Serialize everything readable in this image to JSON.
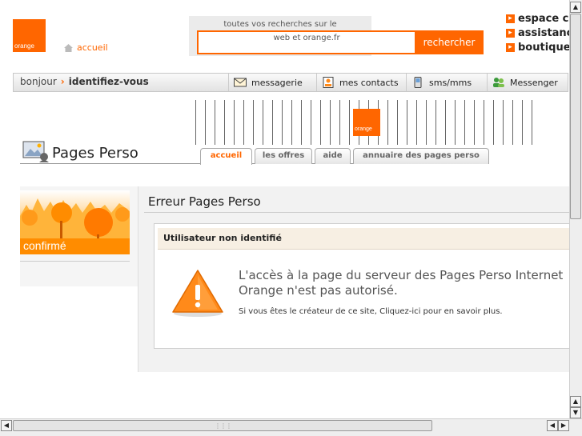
{
  "header": {
    "logo_text": "orange",
    "home_label": "accueil",
    "search": {
      "hint_line1": "toutes vos recherches sur le",
      "placeholder": "web et orange.fr",
      "button_label": "rechercher"
    },
    "quick_links": [
      {
        "label": "espace cli"
      },
      {
        "label": "assistance"
      },
      {
        "label": "boutique"
      }
    ]
  },
  "navbar": {
    "greeting": "bonjour",
    "identify": "identifiez-vous",
    "tabs": [
      {
        "label": "messagerie",
        "icon": "mail-icon"
      },
      {
        "label": "mes contacts",
        "icon": "contacts-icon"
      },
      {
        "label": "sms/mms",
        "icon": "phone-icon"
      },
      {
        "label": "Messenger",
        "icon": "messenger-icon"
      }
    ]
  },
  "banner": {
    "logo_text": "orange"
  },
  "pages_perso": {
    "title": "Pages Perso",
    "tabs": [
      {
        "label": "accueil",
        "active": true
      },
      {
        "label": "les offres"
      },
      {
        "label": "aide"
      },
      {
        "label": "annuaire des pages perso"
      }
    ]
  },
  "promo": {
    "label": "confirmé"
  },
  "error": {
    "title": "Erreur Pages Perso",
    "subtitle": "Utilisateur non identifié",
    "message": "L'accès à la page du serveur des Pages Perso Internet Orange n'est pas autorisé.",
    "hint": "Si vous êtes le créateur de ce site, Cliquez-ici pour en savoir plus."
  },
  "colors": {
    "brand": "#ff6600",
    "warning": "#ff8a1a"
  }
}
